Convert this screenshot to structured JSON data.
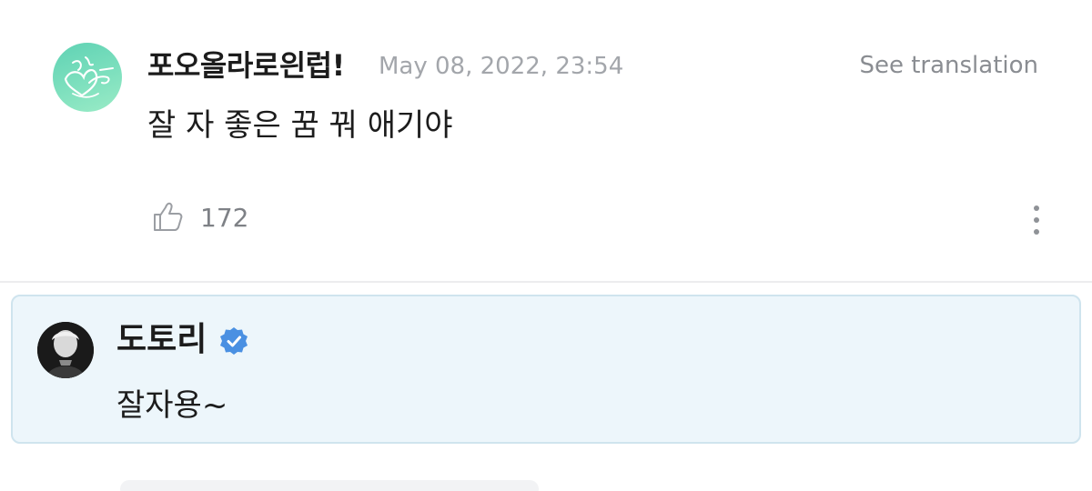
{
  "comment": {
    "author": "포오올라로읜럽!",
    "timestamp": "May 08, 2022, 23:54",
    "see_translation": "See translation",
    "body": "잘 자 좋은 꿈 꿔 애기야",
    "like_count": "172",
    "avatar_icon": "heart-signature-icon"
  },
  "reply": {
    "author": "도토리",
    "verified": true,
    "body": "잘자용~"
  },
  "colors": {
    "reply_background": "#edf6fb",
    "reply_border": "#cfe4ee",
    "verified_badge": "#4a90e2",
    "fan_avatar": "#6fd9b9"
  }
}
